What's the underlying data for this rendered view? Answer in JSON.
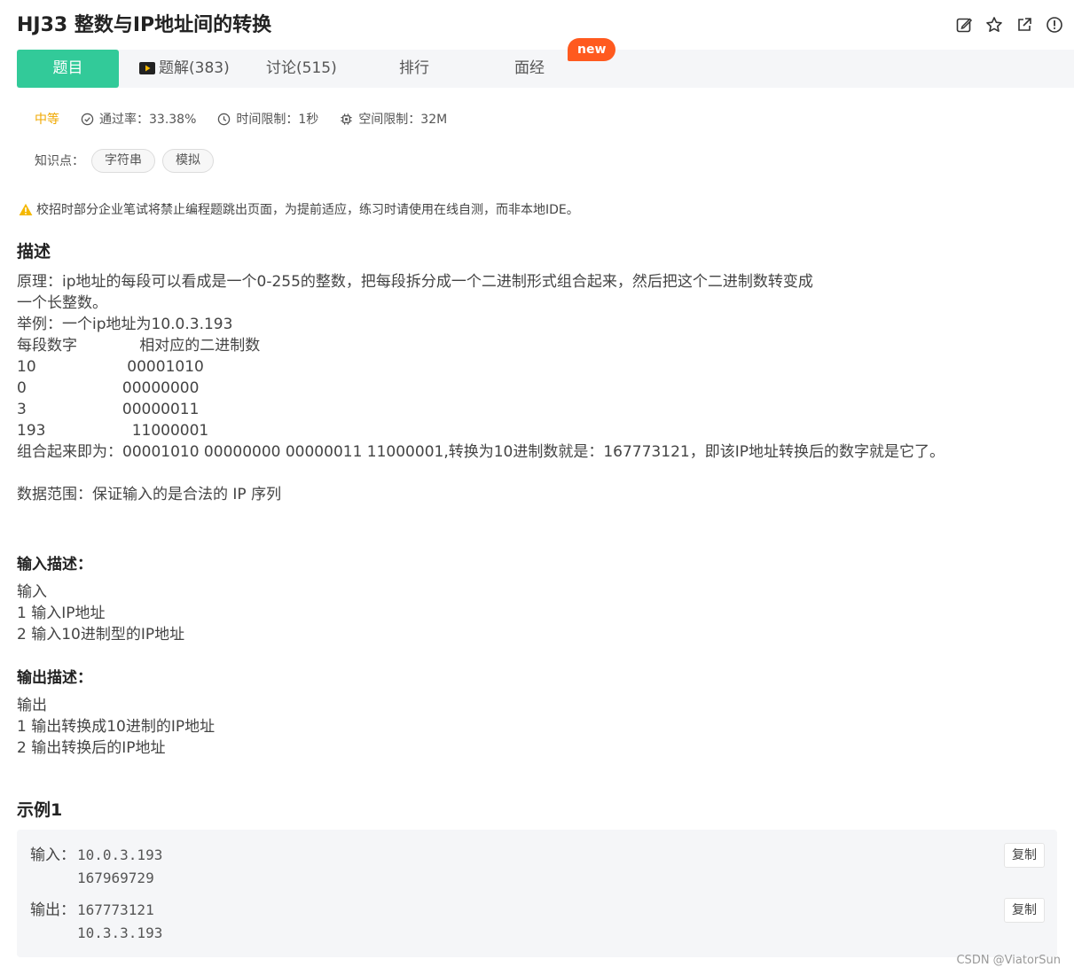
{
  "problem": {
    "title": "HJ33  整数与IP地址间的转换"
  },
  "tabs": [
    {
      "label": "题目"
    },
    {
      "label": "题解(383)"
    },
    {
      "label": "讨论(515)"
    },
    {
      "label": "排行"
    },
    {
      "label": "面经"
    }
  ],
  "new_badge": "new",
  "meta": {
    "difficulty": "中等",
    "pass_rate": "通过率：33.38%",
    "time_limit": "时间限制：1秒",
    "memory_limit": "空间限制：32M"
  },
  "knowledge": {
    "label": "知识点：",
    "tags": [
      "字符串",
      "模拟"
    ]
  },
  "warning": "校招时部分企业笔试将禁止编程题跳出页面，为提前适应，练习时请使用在线自测，而非本地IDE。",
  "description": {
    "heading": "描述",
    "body": "原理：ip地址的每段可以看成是一个0-255的整数，把每段拆分成一个二进制形式组合起来，然后把这个二进制数转变成\n一个长整数。\n举例：一个ip地址为10.0.3.193\n每段数字             相对应的二进制数\n10                   00001010\n0                    00000000\n3                    00000011\n193                  11000001\n组合起来即为：00001010 00000000 00000011 11000001,转换为10进制数就是：167773121，即该IP地址转换后的数字就是它了。\n\n数据范围：保证输入的是合法的 IP 序列"
  },
  "input_desc": {
    "heading": "输入描述：",
    "body": "输入\n1 输入IP地址\n2 输入10进制型的IP地址"
  },
  "output_desc": {
    "heading": "输出描述：",
    "body": "输出\n1 输出转换成10进制的IP地址\n2 输出转换后的IP地址"
  },
  "example": {
    "heading": "示例1",
    "input_label": "输入：",
    "input_values": "10.0.3.193\n167969729",
    "output_label": "输出：",
    "output_values": "167773121\n10.3.3.193",
    "copy_label": "复制"
  },
  "watermark": "CSDN @ViatorSun",
  "colors": {
    "accent": "#32ca99",
    "difficulty": "#f0a800",
    "badge": "#ff5a1f",
    "warning": "#f5b800"
  }
}
